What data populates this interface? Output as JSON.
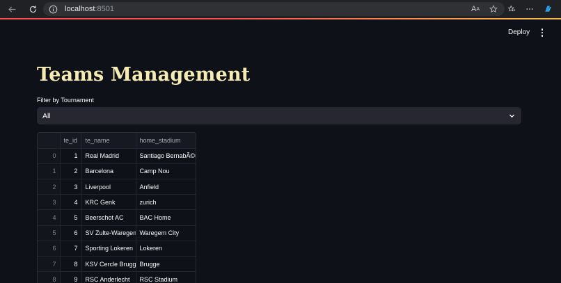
{
  "browser": {
    "url_host": "localhost",
    "url_port": ":8501",
    "read_aloud_label": "A"
  },
  "app": {
    "deploy_label": "Deploy",
    "title": "Teams Management",
    "filter": {
      "label": "Filter by Tournament",
      "selected": "All"
    },
    "table": {
      "columns": [
        "",
        "te_id",
        "te_name",
        "home_stadium"
      ],
      "rows": [
        {
          "index": "0",
          "te_id": "1",
          "te_name": "Real Madrid",
          "home_stadium": "Santiago BernabÃ©u"
        },
        {
          "index": "1",
          "te_id": "2",
          "te_name": "Barcelona",
          "home_stadium": "Camp Nou"
        },
        {
          "index": "2",
          "te_id": "3",
          "te_name": "Liverpool",
          "home_stadium": "Anfield"
        },
        {
          "index": "3",
          "te_id": "4",
          "te_name": "KRC Genk",
          "home_stadium": "zurich"
        },
        {
          "index": "4",
          "te_id": "5",
          "te_name": "Beerschot AC",
          "home_stadium": "BAC Home"
        },
        {
          "index": "5",
          "te_id": "6",
          "te_name": "SV Zulte-Waregem",
          "home_stadium": "Waregem City"
        },
        {
          "index": "6",
          "te_id": "7",
          "te_name": "Sporting Lokeren",
          "home_stadium": "Lokeren"
        },
        {
          "index": "7",
          "te_id": "8",
          "te_name": "KSV Cercle Brugge",
          "home_stadium": "Brugge"
        },
        {
          "index": "8",
          "te_id": "9",
          "te_name": "RSC Anderlecht",
          "home_stadium": "RSC Stadium"
        }
      ]
    }
  },
  "colors": {
    "title": "#f5ebb3",
    "background": "#0e1117",
    "select_bg": "#262730",
    "accent_progress": "#ff4b4b"
  },
  "icons": [
    "back-arrow-icon",
    "refresh-icon",
    "info-icon",
    "read-aloud-icon",
    "favorite-star-icon",
    "favorites-icon",
    "more-icon",
    "copilot-icon",
    "chevron-down-icon",
    "kebab-menu-icon"
  ]
}
